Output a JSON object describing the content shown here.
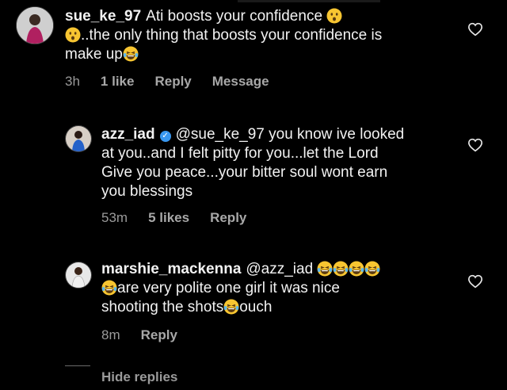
{
  "comments": [
    {
      "username": "sue_ke_97",
      "line1": "Ati boosts your confidence",
      "line2": "..the only thing that boosts your confidence is",
      "line3": "make up",
      "time": "3h",
      "likes": "1 like",
      "reply": "Reply",
      "message": "Message"
    },
    {
      "username": "azz_iad",
      "line1": "@sue_ke_97 you know ive looked",
      "line2": "at you..and I felt pitty for you...let the Lord",
      "line3": "Give you peace...your bitter soul wont earn",
      "line4": "you blessings",
      "time": "53m",
      "likes": "5 likes",
      "reply": "Reply"
    },
    {
      "username": "marshie_mackenna",
      "mention": "@azz_iad",
      "line2": "are very polite one girl it was nice",
      "line3a": "shooting the shots",
      "line3b": "ouch",
      "time": "8m",
      "reply": "Reply"
    }
  ],
  "hide_replies": "Hide replies",
  "icons": {
    "verified": "verified-badge-icon",
    "heart": "heart-outline-icon",
    "surprised": "surprised-face-emoji",
    "laughing": "tears-of-joy-emoji"
  },
  "colors": {
    "background": "#000000",
    "text": "#f2f2f2",
    "muted": "#9a9a9a",
    "verified": "#3897f0",
    "emoji": "#f7c531"
  }
}
